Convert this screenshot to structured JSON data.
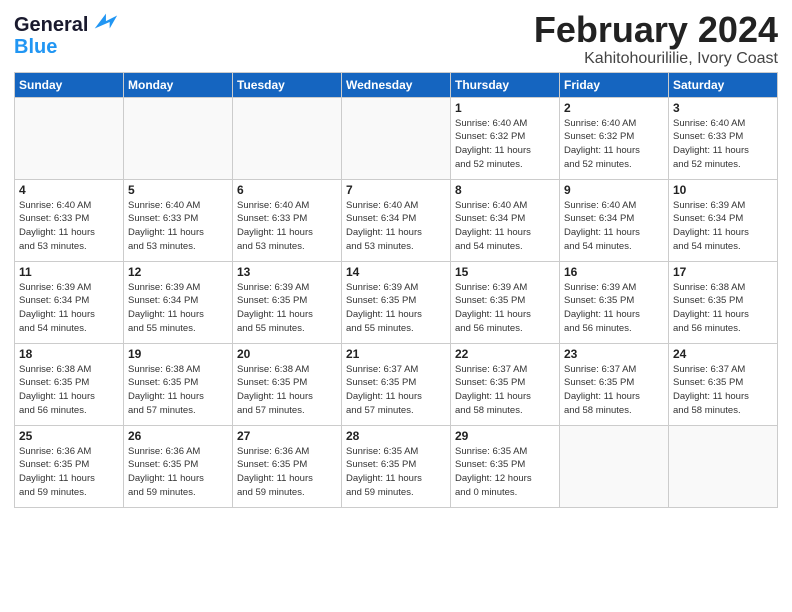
{
  "logo": {
    "line1": "General",
    "line2": "Blue"
  },
  "title": {
    "month_year": "February 2024",
    "location": "Kahitohourililie, Ivory Coast"
  },
  "weekdays": [
    "Sunday",
    "Monday",
    "Tuesday",
    "Wednesday",
    "Thursday",
    "Friday",
    "Saturday"
  ],
  "weeks": [
    [
      {
        "day": "",
        "info": ""
      },
      {
        "day": "",
        "info": ""
      },
      {
        "day": "",
        "info": ""
      },
      {
        "day": "",
        "info": ""
      },
      {
        "day": "1",
        "info": "Sunrise: 6:40 AM\nSunset: 6:32 PM\nDaylight: 11 hours\nand 52 minutes."
      },
      {
        "day": "2",
        "info": "Sunrise: 6:40 AM\nSunset: 6:32 PM\nDaylight: 11 hours\nand 52 minutes."
      },
      {
        "day": "3",
        "info": "Sunrise: 6:40 AM\nSunset: 6:33 PM\nDaylight: 11 hours\nand 52 minutes."
      }
    ],
    [
      {
        "day": "4",
        "info": "Sunrise: 6:40 AM\nSunset: 6:33 PM\nDaylight: 11 hours\nand 53 minutes."
      },
      {
        "day": "5",
        "info": "Sunrise: 6:40 AM\nSunset: 6:33 PM\nDaylight: 11 hours\nand 53 minutes."
      },
      {
        "day": "6",
        "info": "Sunrise: 6:40 AM\nSunset: 6:33 PM\nDaylight: 11 hours\nand 53 minutes."
      },
      {
        "day": "7",
        "info": "Sunrise: 6:40 AM\nSunset: 6:34 PM\nDaylight: 11 hours\nand 53 minutes."
      },
      {
        "day": "8",
        "info": "Sunrise: 6:40 AM\nSunset: 6:34 PM\nDaylight: 11 hours\nand 54 minutes."
      },
      {
        "day": "9",
        "info": "Sunrise: 6:40 AM\nSunset: 6:34 PM\nDaylight: 11 hours\nand 54 minutes."
      },
      {
        "day": "10",
        "info": "Sunrise: 6:39 AM\nSunset: 6:34 PM\nDaylight: 11 hours\nand 54 minutes."
      }
    ],
    [
      {
        "day": "11",
        "info": "Sunrise: 6:39 AM\nSunset: 6:34 PM\nDaylight: 11 hours\nand 54 minutes."
      },
      {
        "day": "12",
        "info": "Sunrise: 6:39 AM\nSunset: 6:34 PM\nDaylight: 11 hours\nand 55 minutes."
      },
      {
        "day": "13",
        "info": "Sunrise: 6:39 AM\nSunset: 6:35 PM\nDaylight: 11 hours\nand 55 minutes."
      },
      {
        "day": "14",
        "info": "Sunrise: 6:39 AM\nSunset: 6:35 PM\nDaylight: 11 hours\nand 55 minutes."
      },
      {
        "day": "15",
        "info": "Sunrise: 6:39 AM\nSunset: 6:35 PM\nDaylight: 11 hours\nand 56 minutes."
      },
      {
        "day": "16",
        "info": "Sunrise: 6:39 AM\nSunset: 6:35 PM\nDaylight: 11 hours\nand 56 minutes."
      },
      {
        "day": "17",
        "info": "Sunrise: 6:38 AM\nSunset: 6:35 PM\nDaylight: 11 hours\nand 56 minutes."
      }
    ],
    [
      {
        "day": "18",
        "info": "Sunrise: 6:38 AM\nSunset: 6:35 PM\nDaylight: 11 hours\nand 56 minutes."
      },
      {
        "day": "19",
        "info": "Sunrise: 6:38 AM\nSunset: 6:35 PM\nDaylight: 11 hours\nand 57 minutes."
      },
      {
        "day": "20",
        "info": "Sunrise: 6:38 AM\nSunset: 6:35 PM\nDaylight: 11 hours\nand 57 minutes."
      },
      {
        "day": "21",
        "info": "Sunrise: 6:37 AM\nSunset: 6:35 PM\nDaylight: 11 hours\nand 57 minutes."
      },
      {
        "day": "22",
        "info": "Sunrise: 6:37 AM\nSunset: 6:35 PM\nDaylight: 11 hours\nand 58 minutes."
      },
      {
        "day": "23",
        "info": "Sunrise: 6:37 AM\nSunset: 6:35 PM\nDaylight: 11 hours\nand 58 minutes."
      },
      {
        "day": "24",
        "info": "Sunrise: 6:37 AM\nSunset: 6:35 PM\nDaylight: 11 hours\nand 58 minutes."
      }
    ],
    [
      {
        "day": "25",
        "info": "Sunrise: 6:36 AM\nSunset: 6:35 PM\nDaylight: 11 hours\nand 59 minutes."
      },
      {
        "day": "26",
        "info": "Sunrise: 6:36 AM\nSunset: 6:35 PM\nDaylight: 11 hours\nand 59 minutes."
      },
      {
        "day": "27",
        "info": "Sunrise: 6:36 AM\nSunset: 6:35 PM\nDaylight: 11 hours\nand 59 minutes."
      },
      {
        "day": "28",
        "info": "Sunrise: 6:35 AM\nSunset: 6:35 PM\nDaylight: 11 hours\nand 59 minutes."
      },
      {
        "day": "29",
        "info": "Sunrise: 6:35 AM\nSunset: 6:35 PM\nDaylight: 12 hours\nand 0 minutes."
      },
      {
        "day": "",
        "info": ""
      },
      {
        "day": "",
        "info": ""
      }
    ]
  ]
}
